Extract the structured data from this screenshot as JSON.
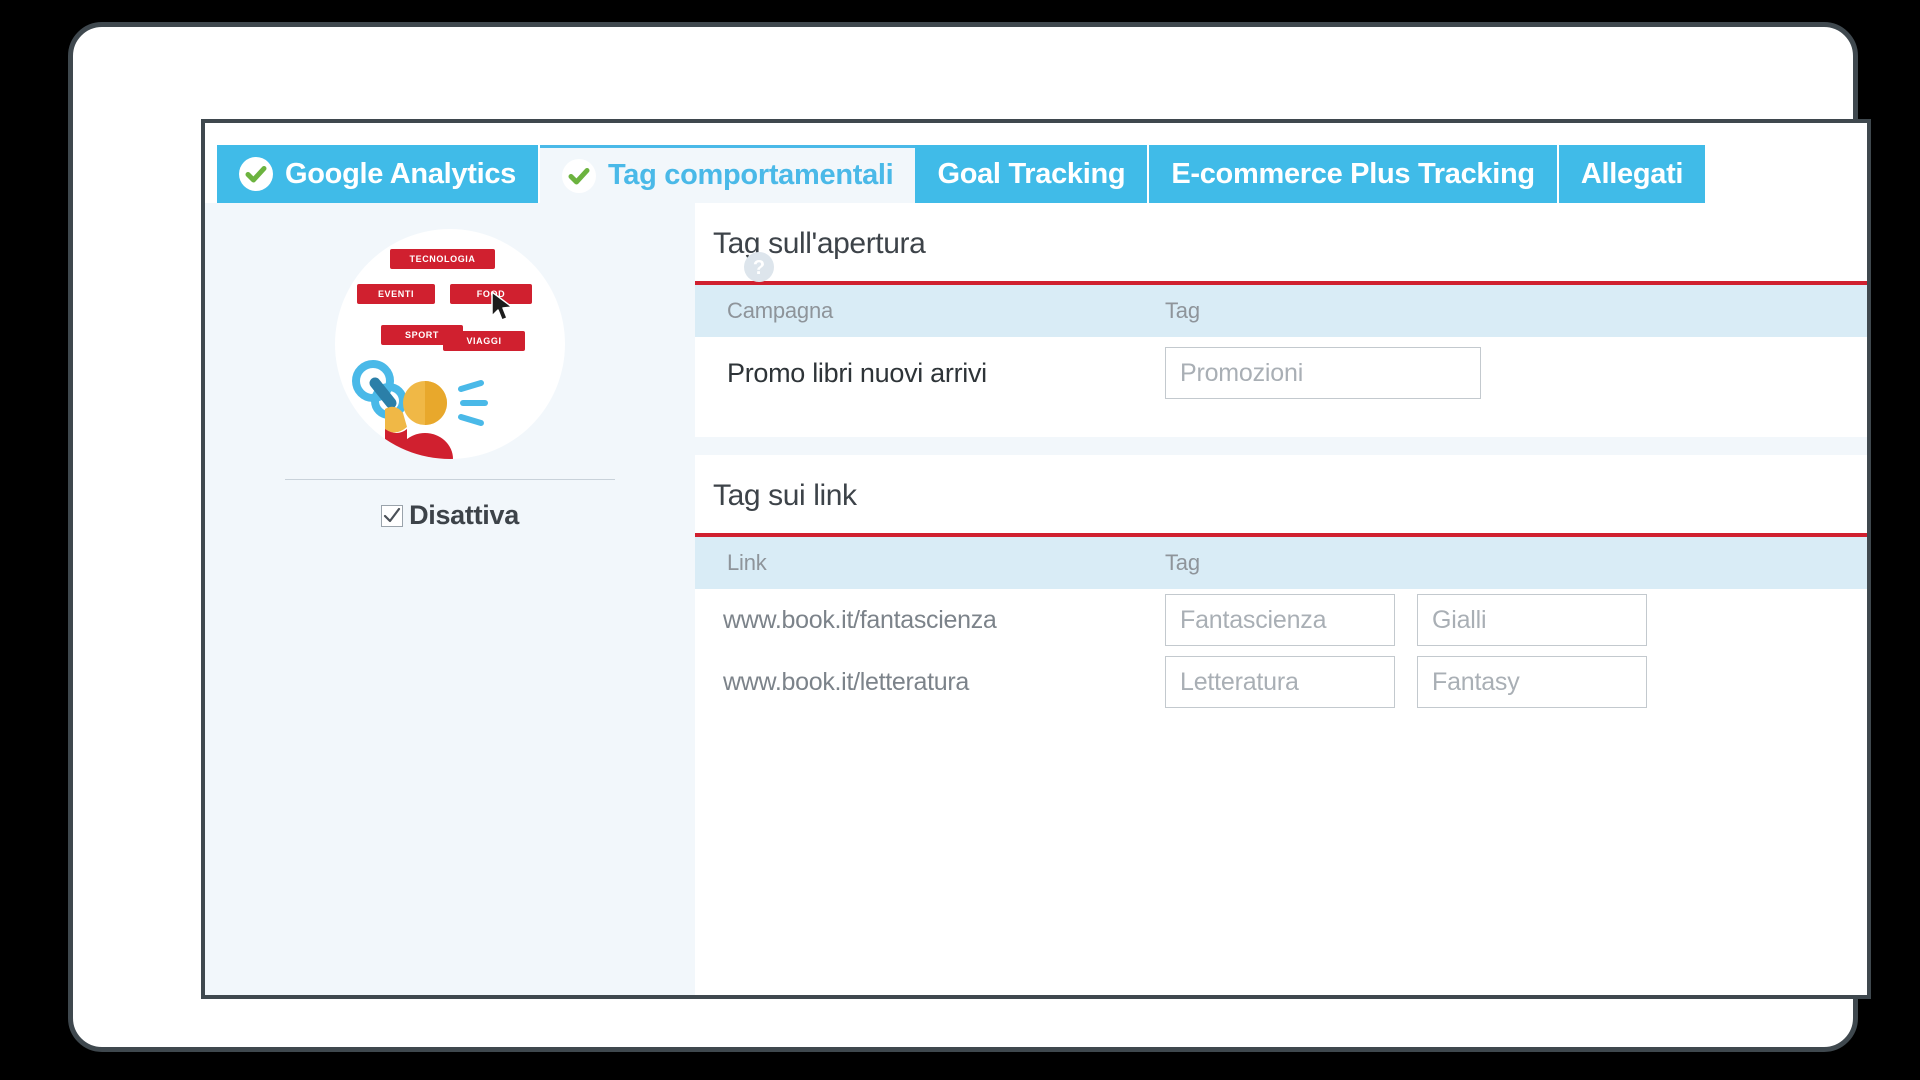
{
  "colors": {
    "tab_blue": "#40bbe8",
    "active_tab_text": "#4ab9e8",
    "check_green": "#6cb33f",
    "accent_red": "#d0202f",
    "table_head_bg": "#d9ecf6",
    "page_bg": "#f2f7fb",
    "frame_border": "#3f484e"
  },
  "tabs": [
    {
      "label": "Google Analytics",
      "icon": "check-circle-icon",
      "active": false
    },
    {
      "label": "Tag comportamentali",
      "icon": "check-circle-icon",
      "active": true
    },
    {
      "label": "Goal Tracking",
      "icon": "",
      "active": false
    },
    {
      "label": "E-commerce Plus Tracking",
      "icon": "",
      "active": false
    },
    {
      "label": "Allegati",
      "icon": "",
      "active": false
    }
  ],
  "sidebar": {
    "help_icon": "help-circle-icon",
    "illustration": {
      "name": "behavioral-tags-illustration",
      "tags": [
        "TECNOLOGIA",
        "EVENTI",
        "FOOD",
        "SPORT",
        "VIAGGI"
      ],
      "cursor_icon": "mouse-pointer-icon",
      "person_icon": "person-with-chain-icon"
    },
    "disattiva": {
      "label": "Disattiva",
      "checked": true
    }
  },
  "main": {
    "sections": [
      {
        "title": "Tag sull'apertura",
        "columns": [
          "Campagna",
          "Tag"
        ],
        "rows": [
          {
            "name": "Promo libri nuovi arrivi",
            "tags": [
              {
                "value": "",
                "placeholder": "Promozioni"
              }
            ]
          }
        ]
      },
      {
        "title": "Tag sui link",
        "columns": [
          "Link",
          "Tag"
        ],
        "rows": [
          {
            "name": "www.book.it/fantascienza",
            "tags": [
              {
                "value": "",
                "placeholder": "Fantascienza"
              },
              {
                "value": "",
                "placeholder": "Gialli"
              }
            ]
          },
          {
            "name": "www.book.it/letteratura",
            "tags": [
              {
                "value": "",
                "placeholder": "Letteratura"
              },
              {
                "value": "",
                "placeholder": "Fantasy"
              }
            ]
          }
        ]
      }
    ]
  }
}
